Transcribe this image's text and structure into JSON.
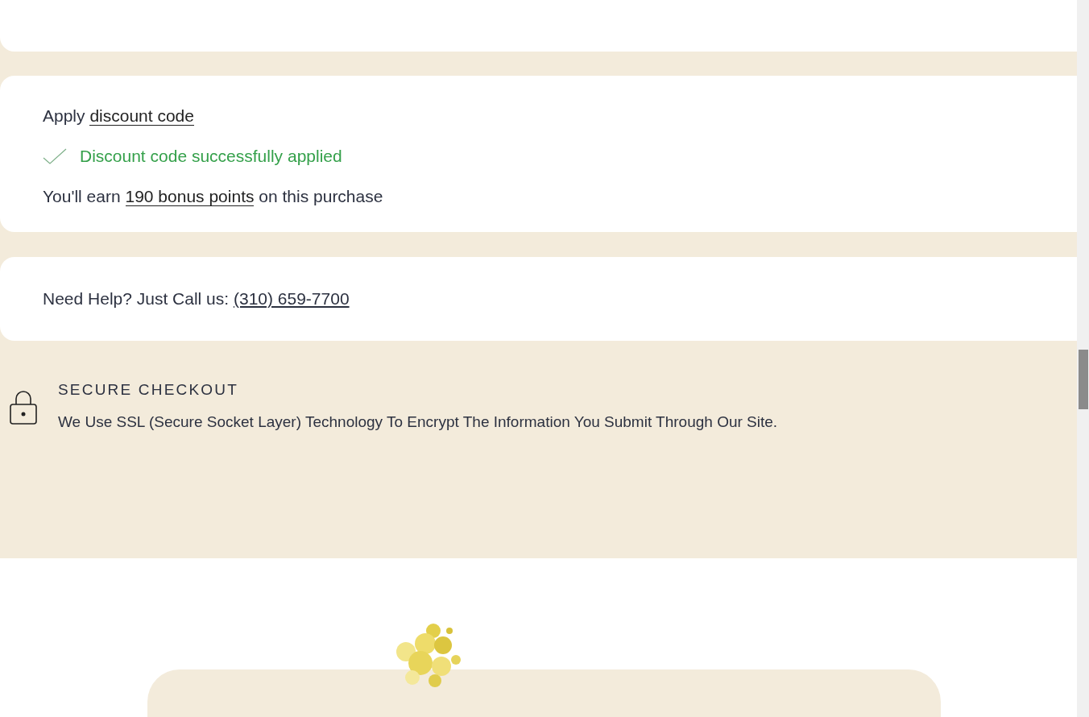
{
  "discount": {
    "prefix": "Apply",
    "link": "discount code"
  },
  "status": {
    "message": "Discount code successfully applied"
  },
  "points": {
    "before": "You'll earn",
    "link": "190 bonus points",
    "after": "on this purchase"
  },
  "help": {
    "label": "Need Help? Just Call us:",
    "phone": "(310) 659-7700"
  },
  "secure": {
    "title": "SECURE CHECKOUT",
    "text": "We Use SSL (Secure Socket Layer) Technology To Encrypt The Information You Submit Through Our Site."
  }
}
